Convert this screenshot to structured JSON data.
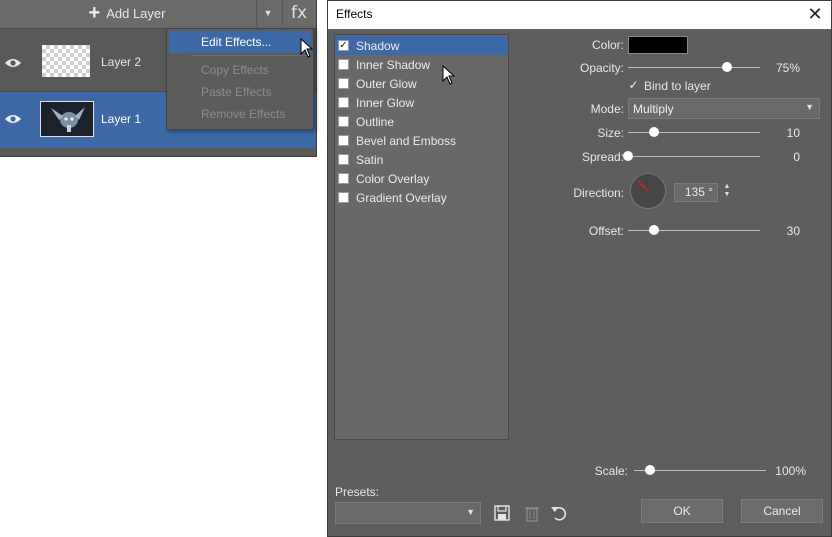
{
  "layers_panel": {
    "add_layer_label": "Add Layer",
    "fx_label": "fx",
    "layers": [
      {
        "name": "Layer 2",
        "visible": true,
        "selected": false
      },
      {
        "name": "Layer 1",
        "visible": true,
        "selected": true
      }
    ]
  },
  "context_menu": {
    "items": [
      {
        "label": "Edit Effects...",
        "enabled": true,
        "highlighted": true
      },
      {
        "label": "Copy Effects",
        "enabled": false
      },
      {
        "label": "Paste Effects",
        "enabled": false
      },
      {
        "label": "Remove Effects",
        "enabled": false
      }
    ]
  },
  "dialog": {
    "title": "Effects",
    "close_glyph": "✕",
    "effects": [
      {
        "label": "Shadow",
        "checked": true,
        "selected": true
      },
      {
        "label": "Inner Shadow",
        "checked": false
      },
      {
        "label": "Outer Glow",
        "checked": false
      },
      {
        "label": "Inner Glow",
        "checked": false
      },
      {
        "label": "Outline",
        "checked": false
      },
      {
        "label": "Bevel and Emboss",
        "checked": false
      },
      {
        "label": "Satin",
        "checked": false
      },
      {
        "label": "Color Overlay",
        "checked": false
      },
      {
        "label": "Gradient Overlay",
        "checked": false
      }
    ],
    "props": {
      "color_label": "Color:",
      "color_value": "#000000",
      "opacity_label": "Opacity:",
      "opacity_value": "75%",
      "opacity_fraction": 0.75,
      "bind_label": "Bind to layer",
      "bind_checked": true,
      "mode_label": "Mode:",
      "mode_value": "Multiply",
      "size_label": "Size:",
      "size_value": "10",
      "size_fraction": 0.2,
      "spread_label": "Spread:",
      "spread_value": "0",
      "spread_fraction": 0.0,
      "direction_label": "Direction:",
      "direction_value": "135 °",
      "offset_label": "Offset:",
      "offset_value": "30",
      "offset_fraction": 0.2
    },
    "scale_label": "Scale:",
    "scale_value": "100%",
    "scale_fraction": 0.12,
    "presets_label": "Presets:",
    "ok_label": "OK",
    "cancel_label": "Cancel"
  },
  "colors": {
    "accent": "#3d6aa7",
    "panel": "#5e5e5e",
    "direction_needle": "#d02020"
  }
}
